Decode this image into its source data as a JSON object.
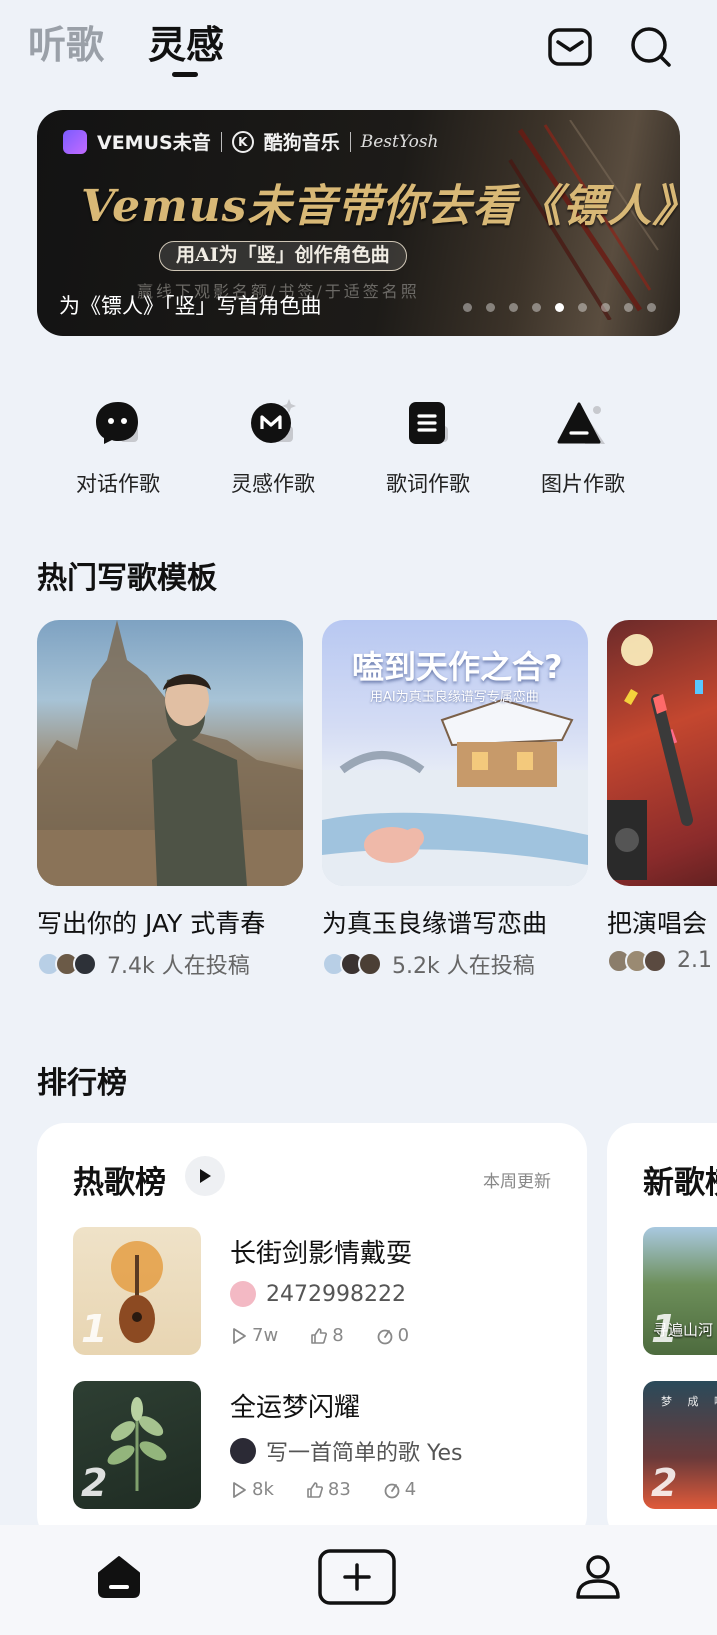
{
  "header": {
    "tabs": [
      {
        "label": "听歌"
      },
      {
        "label": "灵感"
      }
    ],
    "active_tab": "灵感"
  },
  "banner": {
    "brand_vemus": "VEMUS未音",
    "brand_kugou": "酷狗音乐",
    "brand_script": "BestYosh",
    "title": "Vemus未音带你去看《镖人》",
    "pill": "用AI为「竖」创作角色曲",
    "faint_line": "赢线下观影名额/书签/于适签名照",
    "caption": "为《镖人》「竖」写首角色曲",
    "dots_total": 9,
    "dots_active_index": 4
  },
  "quick_actions": [
    {
      "label": "对话作歌",
      "icon": "chat-bubble-icon"
    },
    {
      "label": "灵感作歌",
      "icon": "inspiration-icon"
    },
    {
      "label": "歌词作歌",
      "icon": "lyrics-icon"
    },
    {
      "label": "图片作歌",
      "icon": "image-icon"
    }
  ],
  "sections": {
    "templates_title": "热门写歌模板",
    "ranking_title": "排行榜"
  },
  "templates": [
    {
      "title": "写出你的 JAY 式青春",
      "count": "7.4k 人在投稿"
    },
    {
      "title": "为真玉良缘谱写恋曲",
      "count": "5.2k 人在投稿",
      "overlay_title": "嗑到天作之合?",
      "overlay_sub": "用AI为真玉良缘谱写专属恋曲"
    },
    {
      "title": "把演唱会",
      "count": "2.1"
    }
  ],
  "ranking": {
    "hot": {
      "title": "热歌榜",
      "update": "本周更新",
      "songs": [
        {
          "rank": "1",
          "name": "长街剑影情戴耍",
          "author": "2472998222",
          "plays": "7w",
          "likes": "8",
          "uses": "0"
        },
        {
          "rank": "2",
          "name": "全运梦闪耀",
          "author": "写一首简单的歌 Yes",
          "plays": "8k",
          "likes": "83",
          "uses": "4"
        }
      ]
    },
    "new": {
      "title": "新歌榜",
      "songs": [
        {
          "rank": "1",
          "cover_text": "寻遍山河"
        },
        {
          "rank": "2",
          "cover_text": "梦 成 啊"
        }
      ]
    }
  },
  "bottom_nav": [
    {
      "label": "home",
      "icon": "home-icon"
    },
    {
      "label": "create",
      "icon": "plus-icon"
    },
    {
      "label": "profile",
      "icon": "profile-icon"
    }
  ],
  "colors": {
    "background": "#eef2f8",
    "banner_gold": "#d8b876",
    "text_primary": "#111111",
    "text_secondary": "#888888"
  }
}
